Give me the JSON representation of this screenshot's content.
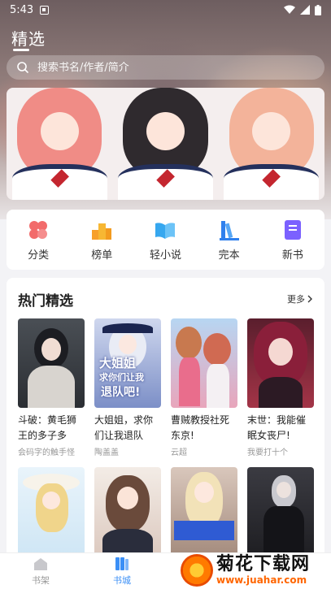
{
  "status_bar": {
    "time": "5:43"
  },
  "header": {
    "title": "精选"
  },
  "search": {
    "placeholder": "搜索书名/作者/简介"
  },
  "categories": [
    {
      "label": "分类",
      "icon": "flower-icon"
    },
    {
      "label": "榜单",
      "icon": "podium-icon"
    },
    {
      "label": "轻小说",
      "icon": "book-open-icon"
    },
    {
      "label": "完本",
      "icon": "books-shelf-icon"
    },
    {
      "label": "新书",
      "icon": "new-book-icon"
    }
  ],
  "hot": {
    "title": "热门精选",
    "more": "更多",
    "books": [
      {
        "title": "斗破：黄毛狮王的多子多福…",
        "author": "会码字的触手怪"
      },
      {
        "title": "大姐姐，求你们让我退队吧！",
        "author": "陶盖盖"
      },
      {
        "title": "曹贼教授社死东京!",
        "author": "云超"
      },
      {
        "title": "末世：我能催眠女丧尸!",
        "author": "我要打十个"
      },
      {
        "title": "",
        "author": ""
      },
      {
        "title": "",
        "author": ""
      },
      {
        "title": "",
        "author": ""
      },
      {
        "title": "",
        "author": ""
      }
    ],
    "covers": {
      "book2_line1": "大姐姐",
      "book2_line2": "求你们让我",
      "book2_line3": "退队吧!"
    }
  },
  "bottom_nav": [
    {
      "label": "书架"
    },
    {
      "label": "书城"
    }
  ],
  "watermark": {
    "title": "菊花下载网",
    "url": "www.juahar.com"
  },
  "colors": {
    "accent": "#3b8ff6",
    "watermark_orange": "#ff6600"
  }
}
